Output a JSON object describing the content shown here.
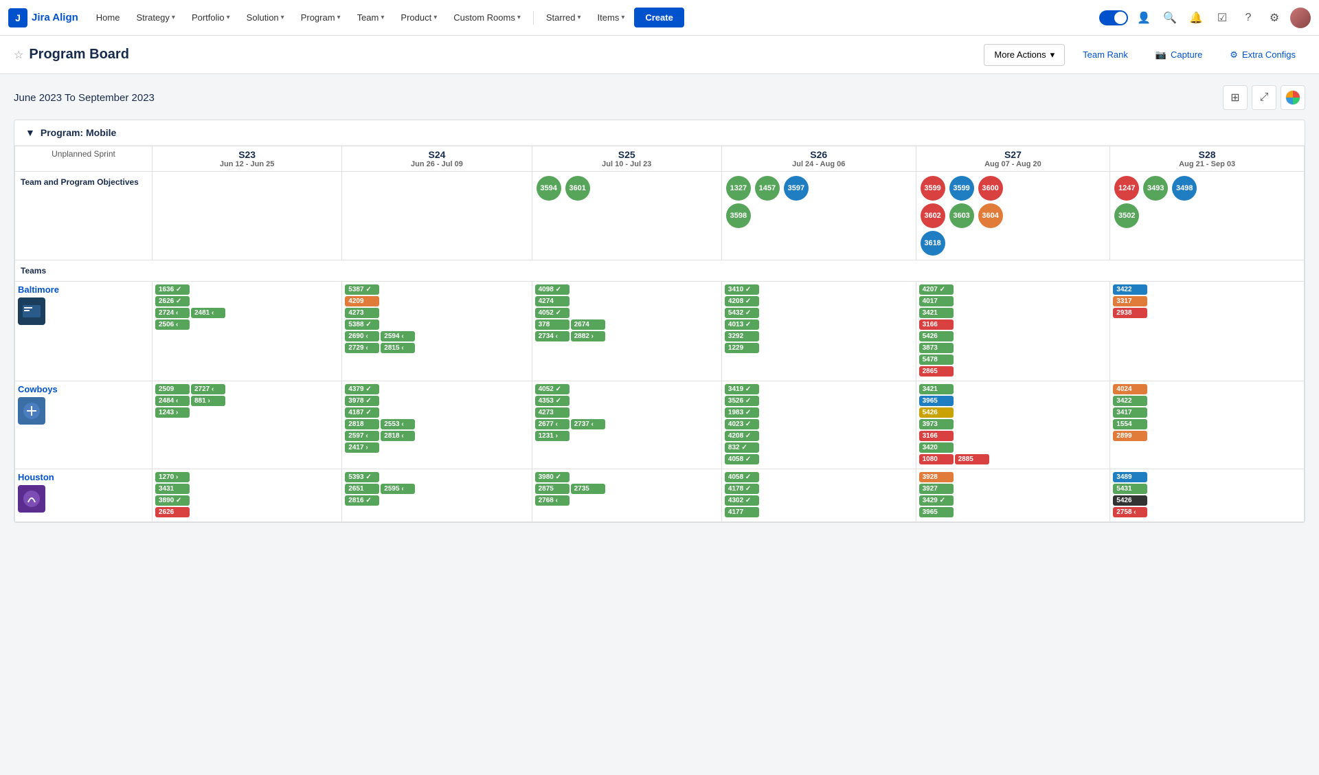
{
  "nav": {
    "logo_text": "Jira Align",
    "items": [
      {
        "label": "Home",
        "has_dropdown": false
      },
      {
        "label": "Strategy",
        "has_dropdown": true
      },
      {
        "label": "Portfolio",
        "has_dropdown": true
      },
      {
        "label": "Solution",
        "has_dropdown": true
      },
      {
        "label": "Program",
        "has_dropdown": true
      },
      {
        "label": "Team",
        "has_dropdown": true
      },
      {
        "label": "Product",
        "has_dropdown": true
      },
      {
        "label": "Custom Rooms",
        "has_dropdown": true
      },
      {
        "label": "Starred",
        "has_dropdown": true
      },
      {
        "label": "Items",
        "has_dropdown": true
      }
    ],
    "create_label": "Create"
  },
  "page": {
    "title": "Program Board",
    "more_actions": "More Actions",
    "team_rank": "Team Rank",
    "capture": "Capture",
    "extra_configs": "Extra Configs"
  },
  "board": {
    "date_range": "June 2023 To September 2023",
    "program_label": "Program: Mobile",
    "unplanned_label": "Unplanned Sprint",
    "sprints": [
      {
        "name": "S23",
        "dates": "Jun 12 - Jun 25"
      },
      {
        "name": "S24",
        "dates": "Jun 26 - Jul 09"
      },
      {
        "name": "S25",
        "dates": "Jul 10 - Jul 23"
      },
      {
        "name": "S26",
        "dates": "Jul 24 - Aug 06"
      },
      {
        "name": "S27",
        "dates": "Aug 07 - Aug 20"
      },
      {
        "name": "S28",
        "dates": "Aug 21 - Sep 03"
      }
    ],
    "objectives_label": "Team and Program Objectives",
    "teams_label": "Teams"
  }
}
